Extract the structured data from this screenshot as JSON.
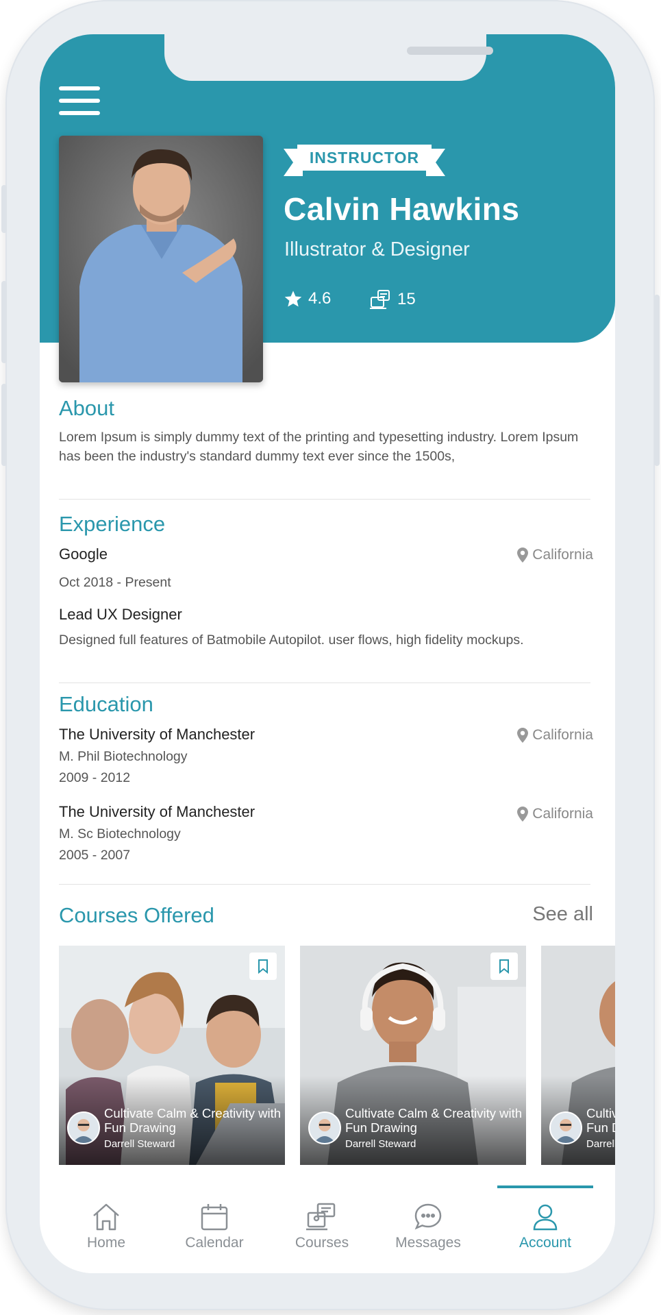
{
  "header": {
    "badge": "INSTRUCTOR",
    "name": "Calvin Hawkins",
    "role": "Illustrator & Designer",
    "rating": "4.6",
    "courses_count": "15"
  },
  "about": {
    "title": "About",
    "text": "Lorem Ipsum is simply dummy text of the printing and typesetting industry. Lorem Ipsum has been the industry's standard dummy text ever since the 1500s,"
  },
  "experience": {
    "title": "Experience",
    "company": "Google",
    "location": "California",
    "period": "Oct 2018 - Present",
    "position": "Lead UX Designer",
    "description": "Designed full features of Batmobile Autopilot. user flows, high fidelity mockups."
  },
  "education": {
    "title": "Education",
    "items": [
      {
        "school": "The University of Manchester",
        "degree": "M. Phil Biotechnology",
        "years": "2009 - 2012",
        "location": "California"
      },
      {
        "school": "The University of Manchester",
        "degree": "M. Sc Biotechnology",
        "years": "2005 - 2007",
        "location": "California"
      }
    ]
  },
  "courses": {
    "title": "Courses Offered",
    "see_all": "See all",
    "items": [
      {
        "title": "Cultivate Calm & Creativity with Fun Drawing",
        "author": "Darrell Steward"
      },
      {
        "title": "Cultivate Calm & Creativity with Fun Drawing",
        "author": "Darrell Steward"
      },
      {
        "title": "Cultivate Calm & Creativity with Fun Drawing",
        "author": "Darrell Steward"
      }
    ]
  },
  "tabs": [
    {
      "label": "Home",
      "icon": "home-icon"
    },
    {
      "label": "Calendar",
      "icon": "calendar-icon"
    },
    {
      "label": "Courses",
      "icon": "courses-icon"
    },
    {
      "label": "Messages",
      "icon": "messages-icon"
    },
    {
      "label": "Account",
      "icon": "account-icon",
      "active": true
    }
  ],
  "colors": {
    "accent": "#2a97ac",
    "muted": "#8a8f94"
  }
}
